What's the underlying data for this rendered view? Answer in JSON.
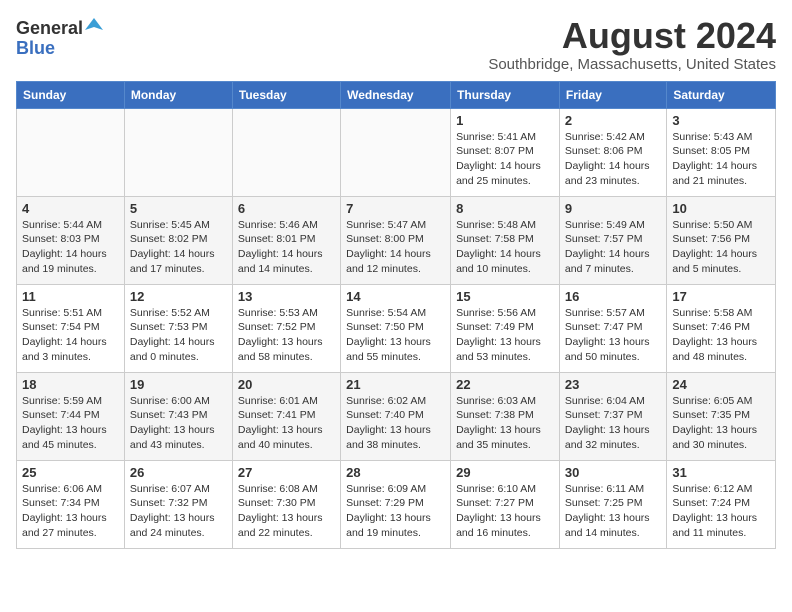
{
  "logo": {
    "general": "General",
    "blue": "Blue"
  },
  "title": "August 2024",
  "location": "Southbridge, Massachusetts, United States",
  "days_of_week": [
    "Sunday",
    "Monday",
    "Tuesday",
    "Wednesday",
    "Thursday",
    "Friday",
    "Saturday"
  ],
  "weeks": [
    [
      {
        "day": "",
        "info": ""
      },
      {
        "day": "",
        "info": ""
      },
      {
        "day": "",
        "info": ""
      },
      {
        "day": "",
        "info": ""
      },
      {
        "day": "1",
        "info": "Sunrise: 5:41 AM\nSunset: 8:07 PM\nDaylight: 14 hours and 25 minutes."
      },
      {
        "day": "2",
        "info": "Sunrise: 5:42 AM\nSunset: 8:06 PM\nDaylight: 14 hours and 23 minutes."
      },
      {
        "day": "3",
        "info": "Sunrise: 5:43 AM\nSunset: 8:05 PM\nDaylight: 14 hours and 21 minutes."
      }
    ],
    [
      {
        "day": "4",
        "info": "Sunrise: 5:44 AM\nSunset: 8:03 PM\nDaylight: 14 hours and 19 minutes."
      },
      {
        "day": "5",
        "info": "Sunrise: 5:45 AM\nSunset: 8:02 PM\nDaylight: 14 hours and 17 minutes."
      },
      {
        "day": "6",
        "info": "Sunrise: 5:46 AM\nSunset: 8:01 PM\nDaylight: 14 hours and 14 minutes."
      },
      {
        "day": "7",
        "info": "Sunrise: 5:47 AM\nSunset: 8:00 PM\nDaylight: 14 hours and 12 minutes."
      },
      {
        "day": "8",
        "info": "Sunrise: 5:48 AM\nSunset: 7:58 PM\nDaylight: 14 hours and 10 minutes."
      },
      {
        "day": "9",
        "info": "Sunrise: 5:49 AM\nSunset: 7:57 PM\nDaylight: 14 hours and 7 minutes."
      },
      {
        "day": "10",
        "info": "Sunrise: 5:50 AM\nSunset: 7:56 PM\nDaylight: 14 hours and 5 minutes."
      }
    ],
    [
      {
        "day": "11",
        "info": "Sunrise: 5:51 AM\nSunset: 7:54 PM\nDaylight: 14 hours and 3 minutes."
      },
      {
        "day": "12",
        "info": "Sunrise: 5:52 AM\nSunset: 7:53 PM\nDaylight: 14 hours and 0 minutes."
      },
      {
        "day": "13",
        "info": "Sunrise: 5:53 AM\nSunset: 7:52 PM\nDaylight: 13 hours and 58 minutes."
      },
      {
        "day": "14",
        "info": "Sunrise: 5:54 AM\nSunset: 7:50 PM\nDaylight: 13 hours and 55 minutes."
      },
      {
        "day": "15",
        "info": "Sunrise: 5:56 AM\nSunset: 7:49 PM\nDaylight: 13 hours and 53 minutes."
      },
      {
        "day": "16",
        "info": "Sunrise: 5:57 AM\nSunset: 7:47 PM\nDaylight: 13 hours and 50 minutes."
      },
      {
        "day": "17",
        "info": "Sunrise: 5:58 AM\nSunset: 7:46 PM\nDaylight: 13 hours and 48 minutes."
      }
    ],
    [
      {
        "day": "18",
        "info": "Sunrise: 5:59 AM\nSunset: 7:44 PM\nDaylight: 13 hours and 45 minutes."
      },
      {
        "day": "19",
        "info": "Sunrise: 6:00 AM\nSunset: 7:43 PM\nDaylight: 13 hours and 43 minutes."
      },
      {
        "day": "20",
        "info": "Sunrise: 6:01 AM\nSunset: 7:41 PM\nDaylight: 13 hours and 40 minutes."
      },
      {
        "day": "21",
        "info": "Sunrise: 6:02 AM\nSunset: 7:40 PM\nDaylight: 13 hours and 38 minutes."
      },
      {
        "day": "22",
        "info": "Sunrise: 6:03 AM\nSunset: 7:38 PM\nDaylight: 13 hours and 35 minutes."
      },
      {
        "day": "23",
        "info": "Sunrise: 6:04 AM\nSunset: 7:37 PM\nDaylight: 13 hours and 32 minutes."
      },
      {
        "day": "24",
        "info": "Sunrise: 6:05 AM\nSunset: 7:35 PM\nDaylight: 13 hours and 30 minutes."
      }
    ],
    [
      {
        "day": "25",
        "info": "Sunrise: 6:06 AM\nSunset: 7:34 PM\nDaylight: 13 hours and 27 minutes."
      },
      {
        "day": "26",
        "info": "Sunrise: 6:07 AM\nSunset: 7:32 PM\nDaylight: 13 hours and 24 minutes."
      },
      {
        "day": "27",
        "info": "Sunrise: 6:08 AM\nSunset: 7:30 PM\nDaylight: 13 hours and 22 minutes."
      },
      {
        "day": "28",
        "info": "Sunrise: 6:09 AM\nSunset: 7:29 PM\nDaylight: 13 hours and 19 minutes."
      },
      {
        "day": "29",
        "info": "Sunrise: 6:10 AM\nSunset: 7:27 PM\nDaylight: 13 hours and 16 minutes."
      },
      {
        "day": "30",
        "info": "Sunrise: 6:11 AM\nSunset: 7:25 PM\nDaylight: 13 hours and 14 minutes."
      },
      {
        "day": "31",
        "info": "Sunrise: 6:12 AM\nSunset: 7:24 PM\nDaylight: 13 hours and 11 minutes."
      }
    ]
  ]
}
